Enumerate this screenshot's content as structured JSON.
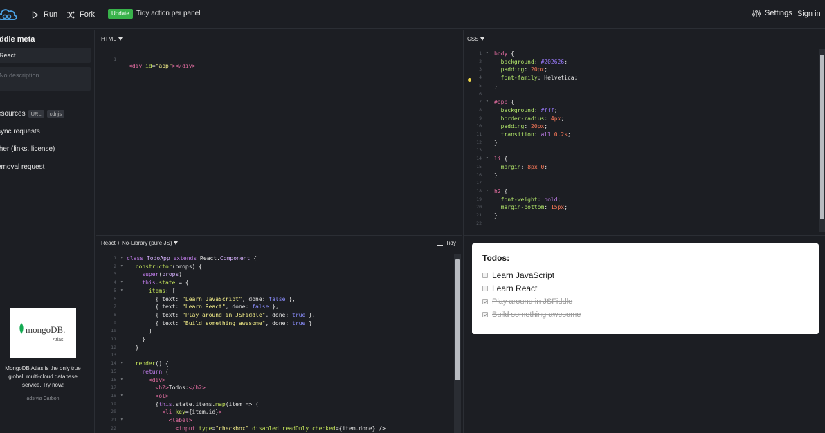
{
  "topbar": {
    "run_label": "Run",
    "fork_label": "Fork",
    "update_badge": "Update",
    "tidy_label": "Tidy action per panel",
    "settings_label": "Settings",
    "signin_label": "Sign in"
  },
  "sidebar": {
    "heading": "iddle meta",
    "name_value": "React",
    "description_placeholder": "No description",
    "resources_label": "esources",
    "resources_tags": [
      "URL",
      "cdnjs"
    ],
    "async_label": "sync requests",
    "other_label": "ther (links, license)",
    "removal_label": "emoval request",
    "ad": {
      "brand": "mongoDB.",
      "sub": "Atlas",
      "text": "MongoDB Atlas is the only true global, multi-cloud database service. Try now!",
      "via": "ads via Carbon"
    }
  },
  "html_panel": {
    "label": "HTML",
    "line_numbers": [
      "1"
    ]
  },
  "css_panel": {
    "label": "CSS",
    "line_numbers": [
      "1",
      "2",
      "3",
      "4",
      "5",
      "6",
      "7",
      "8",
      "9",
      "10",
      "11",
      "12",
      "13",
      "14",
      "15",
      "16",
      "17",
      "18",
      "19",
      "20",
      "21",
      "22"
    ]
  },
  "js_panel": {
    "label": "React + No-Library (pure JS)",
    "tidy_label": "Tidy",
    "line_numbers": [
      "1",
      "2",
      "3",
      "4",
      "5",
      "6",
      "7",
      "8",
      "9",
      "10",
      "11",
      "12",
      "13",
      "14",
      "15",
      "16",
      "17",
      "18",
      "19",
      "20",
      "21",
      "22"
    ]
  },
  "result": {
    "title": "Todos:",
    "items": [
      {
        "text": "Learn JavaScript",
        "done": false
      },
      {
        "text": "Learn React",
        "done": false
      },
      {
        "text": "Play around in JSFiddle",
        "done": true
      },
      {
        "text": "Build something awesome",
        "done": true
      }
    ]
  },
  "colors": {
    "accent_green": "#38b24a",
    "background": "#1c1e23",
    "editor_bg": "#1c1e23"
  }
}
